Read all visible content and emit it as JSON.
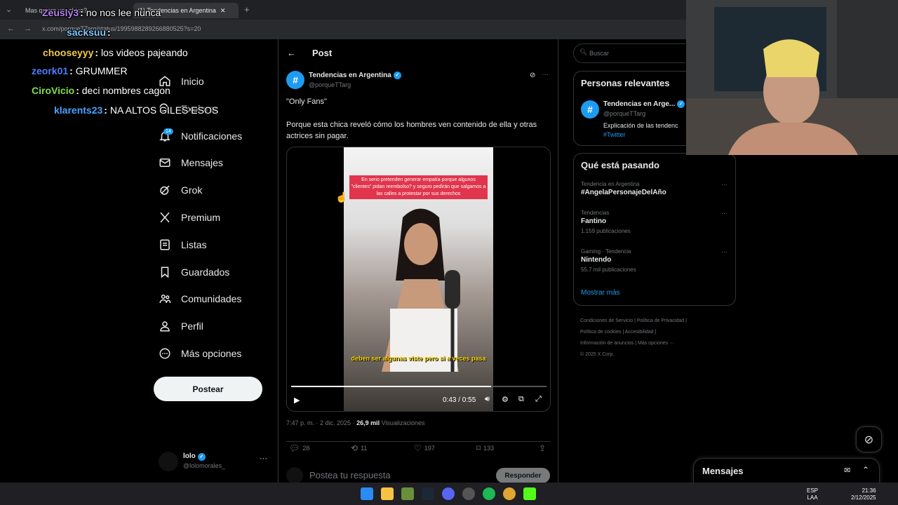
{
  "browser": {
    "tabs": [
      {
        "label": "Mas quiere ver chica?"
      },
      {
        "label": "(1) Tendencias en Argentina",
        "active": true
      }
    ],
    "new_tab": "+",
    "url": "x.com/porqueTTarg/status/1995988289266880525?s=20"
  },
  "chat": [
    {
      "user": "Zeusly3",
      "message": "no nos lee nunca",
      "color": "#b483f2"
    },
    {
      "user": "sacksuu",
      "message": "",
      "color": "#7ec8ff"
    },
    {
      "user": "chooseyyy",
      "message": "los videos pajeando",
      "color": "#f2c94c"
    },
    {
      "user": "zeork01",
      "message": "GRUMMER",
      "color": "#4f7dff"
    },
    {
      "user": "CiroVicio",
      "message": "deci nombres cagon",
      "color": "#7ee04a"
    },
    {
      "user": "klarents23",
      "message": "NA ALTOS GILES ESOS",
      "color": "#4aa3ff"
    }
  ],
  "nav": {
    "items": [
      {
        "label": "Inicio",
        "icon": "home-icon"
      },
      {
        "label": "Explorar",
        "icon": "search-icon"
      },
      {
        "label": "Notificaciones",
        "icon": "bell-icon",
        "badge": "14"
      },
      {
        "label": "Mensajes",
        "icon": "mail-icon"
      },
      {
        "label": "Grok",
        "icon": "grok-icon"
      },
      {
        "label": "Premium",
        "icon": "x-logo-icon"
      },
      {
        "label": "Listas",
        "icon": "list-icon"
      },
      {
        "label": "Guardados",
        "icon": "bookmark-icon"
      },
      {
        "label": "Comunidades",
        "icon": "people-icon"
      },
      {
        "label": "Perfil",
        "icon": "person-icon"
      },
      {
        "label": "Más opciones",
        "icon": "more-circle-icon"
      }
    ],
    "post_button": "Postear",
    "account": {
      "name": "lolo",
      "handle": "@lolomorales_",
      "more": "···"
    }
  },
  "post": {
    "header_title": "Post",
    "author": {
      "name": "Tendencias en Argentina",
      "handle": "@porqueTTarg",
      "avatar_glyph": "#"
    },
    "text_quote": "\"Only Fans\"",
    "text_body": "Porque esta chica reveló cómo los hombres ven contenido de ella y otras actrices sin pagar.",
    "video": {
      "caption_top": "En serio pretenden generar empatía porque algunos \"clientes\" pidan reembolso? y seguro pedirán que salgamos a las calles a protestar por sus derechos",
      "subtitle": "deben ser algunas viste pero si a veces pasa",
      "time": "0:43 / 0:55",
      "progress": 0.782
    },
    "meta": {
      "time": "7:47 p. m. · 2 dic. 2025 · ",
      "views": "26,9 mil",
      "views_label": " Visualizaciones"
    },
    "actions": {
      "replies": "28",
      "reposts": "11",
      "likes": "197",
      "bookmarks": "133"
    },
    "reply_placeholder": "Postea tu respuesta",
    "reply_button": "Responder"
  },
  "sidebar": {
    "search_placeholder": "Buscar",
    "relevant": {
      "title": "Personas relevantes",
      "name": "Tendencias en Arge...",
      "handle": "@porqueTTarg",
      "bio": "Explicación de las tendenc",
      "hashtag": "#Twitter"
    },
    "trends": {
      "title": "Qué está pasando",
      "items": [
        {
          "context": "Tendencia en Argentina",
          "name": "#AngelaPersonajeDelAño",
          "count": ""
        },
        {
          "context": "Tendencias",
          "name": "Fantino",
          "count": "1.159 publicaciones"
        },
        {
          "context": "Gaming · Tendencia",
          "name": "Nintendo",
          "count": "55,7 mil publicaciones"
        }
      ],
      "show_more": "Mostrar más"
    },
    "footer": [
      "Condiciones de Servicio",
      "|",
      "Política de Privacidad",
      "|",
      "Política de cookies",
      "|",
      "Accesibilidad",
      "|",
      "Información de anuncios",
      "|",
      "Más opciones ···",
      "© 2025 X Corp."
    ]
  },
  "messages": {
    "title": "Mensajes"
  },
  "taskbar": {
    "lang1": "ESP",
    "lang2": "LAA",
    "time": "21:36",
    "date": "2/12/2025"
  }
}
